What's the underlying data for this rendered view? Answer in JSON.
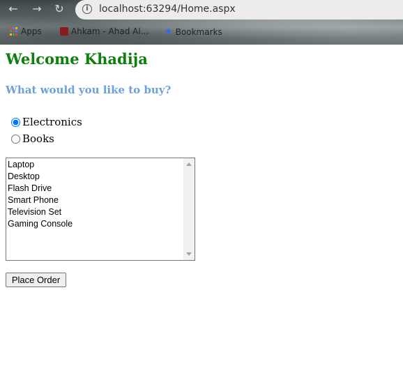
{
  "browser": {
    "url": "localhost:63294/Home.aspx",
    "bookmarks": [
      {
        "label": "Apps",
        "icon": "apps-grid-icon"
      },
      {
        "label": "Ahkam - Ahad Al...",
        "icon": "site-favicon"
      },
      {
        "label": "Bookmarks",
        "icon": "star-icon"
      }
    ]
  },
  "page": {
    "welcome": "Welcome Khadija",
    "question": "What would you like to buy?",
    "categories": [
      {
        "label": "Electronics",
        "checked": true
      },
      {
        "label": "Books",
        "checked": false
      }
    ],
    "products": [
      "Laptop",
      "Desktop",
      "Flash Drive",
      "Smart Phone",
      "Television Set",
      "Gaming Console"
    ],
    "order_button": "Place Order"
  },
  "colors": {
    "welcome": "#0d7f0d",
    "question": "#6f9fd8"
  }
}
